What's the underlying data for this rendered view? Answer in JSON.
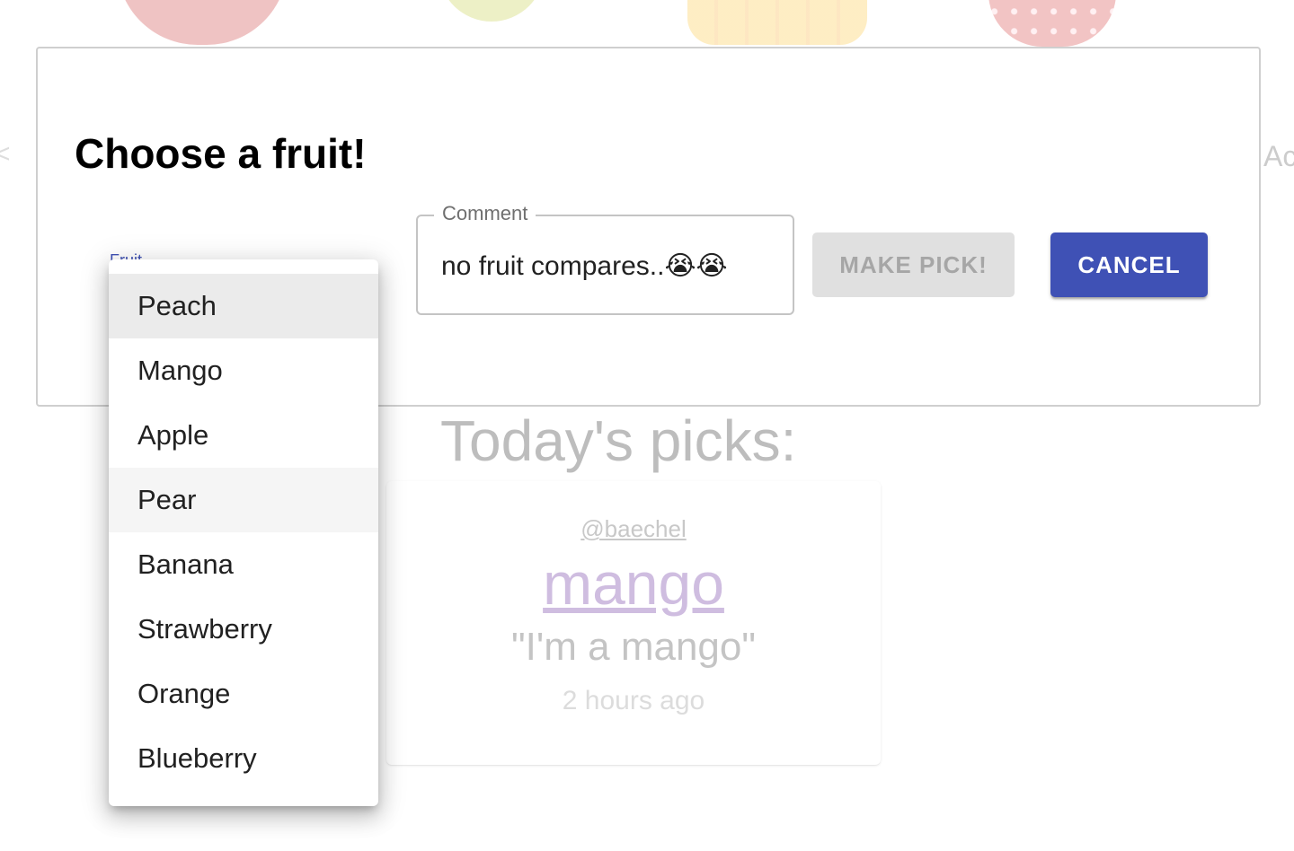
{
  "background": {
    "fruit_images": [
      "apple",
      "pear",
      "banana",
      "strawberry"
    ],
    "edge_text_left": "<",
    "edge_text_right": "Ac",
    "picks_heading": "Today's picks:",
    "pick": {
      "user": "@baechel",
      "fruit": "mango",
      "comment": "\"I'm a mango\"",
      "time": "2 hours ago"
    }
  },
  "dialog": {
    "title": "Choose a fruit!",
    "fruit_select": {
      "label": "Fruit",
      "selected": "Peach",
      "hovered": "Pear",
      "options": [
        "Peach",
        "Mango",
        "Apple",
        "Pear",
        "Banana",
        "Strawberry",
        "Orange",
        "Blueberry"
      ]
    },
    "comment": {
      "label": "Comment",
      "value": "no fruit compares..😭😭"
    },
    "buttons": {
      "make_pick": "MAKE PICK!",
      "cancel": "CANCEL"
    }
  },
  "colors": {
    "primary": "#3f51b5",
    "disabled_button_bg": "#e0e0e0",
    "disabled_button_text": "#a6a6a6"
  }
}
